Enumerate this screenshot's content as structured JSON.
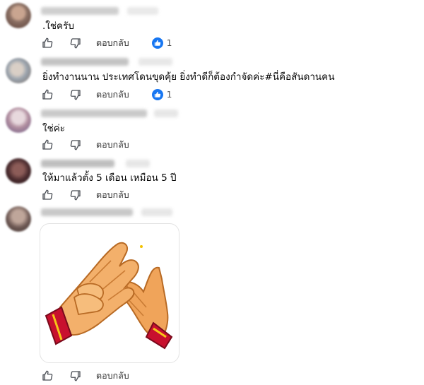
{
  "comments": [
    {
      "text": ".ใช่ครับ",
      "reply_label": "ตอบกลับ",
      "reaction": {
        "icon": "like-reaction-icon",
        "count": "1"
      },
      "avatar_colors": [
        "#8a6f63",
        "#c9a590",
        "#5b4038"
      ],
      "name_color": "#c9c9c9"
    },
    {
      "text": "ยิ่งทำงานนาน ประเทศโดนขุดคุ้ย ยิ่งทำดีก็ต้องกำจัดค่ะ#นี่คือสันดานคน",
      "reply_label": "ตอบกลับ",
      "reaction": {
        "icon": "like-reaction-icon",
        "count": "1"
      },
      "avatar_colors": [
        "#9aa3ad",
        "#d9cfc6",
        "#7d6f66"
      ],
      "name_color": "#bdbdbd"
    },
    {
      "text": "ใช่ค่ะ",
      "reply_label": "ตอบกลับ",
      "avatar_colors": [
        "#b28fa0",
        "#e7d8dd",
        "#6d5a86"
      ],
      "name_color": "#c4c4c4"
    },
    {
      "text": "ให้มาแล้วตั้ง 5 เดือน เหมือน 5 ปี",
      "reply_label": "ตอบกลับ",
      "avatar_colors": [
        "#4a2b2e",
        "#8c5c58",
        "#2a1a1c"
      ],
      "name_color": "#b8b8b8"
    },
    {
      "sticker": "clapping-hands-sticker",
      "reply_label": "ตอบกลับ",
      "avatar_colors": [
        "#6f5a55",
        "#bfa69a",
        "#3d2f2c"
      ],
      "name_color": "#c2c2c2"
    }
  ],
  "colors": {
    "accent": "#1877f2",
    "text": "#050505",
    "icon": "#4b4f56"
  }
}
